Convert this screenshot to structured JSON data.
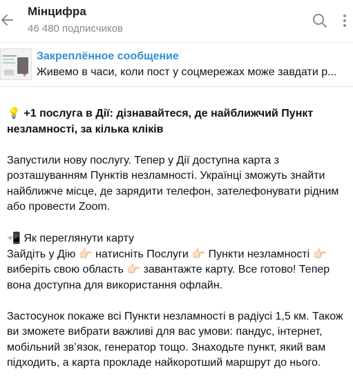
{
  "header": {
    "title": "Мінцифра",
    "subtitle": "46 480 подписчиков",
    "back_icon": "arrow-left-icon",
    "search_icon": "search-icon",
    "more_icon": "more-vertical-icon"
  },
  "pinned": {
    "label": "Закреплённое сообщение",
    "text": "Живемо в часи, коли пост у соцмережах може завдати р..."
  },
  "message": {
    "title_emoji": "💡",
    "title": "+1 послуга в Дії: дізнавайтеся, де найближчий Пункт незламності, за кілька кліків",
    "para1": "Запустили нову послугу. Тепер у Дії доступна карта з розташуванням Пунктів незламності. Українці зможуть знайти найближче місце, де зарядити телефон, зателефонувати рідним або провести Zoom.",
    "how_emoji": "📲",
    "how_title": "Як переглянути карту",
    "steps": "Зайдіть у Дію 👉🏻 натисніть Послуги 👉🏻 Пункти незламності 👉🏻 виберіть свою область 👉🏻 завантажте карту.  Все готово! Тепер вона доступна для використання офлайн.",
    "para3": "Застосунок покаже всі Пункти незламності в радіусі 1,5 км. Також ви зможете вибрати важливі для вас умови: пандус, інтернет, мобільний зв’язок, генератор тощо. Знаходьте пункт, який вам підходить, а карта прокладе найкоротший маршрут до нього."
  },
  "colors": {
    "accent": "#2f8fd6",
    "subtitle": "#8a8a8a"
  }
}
